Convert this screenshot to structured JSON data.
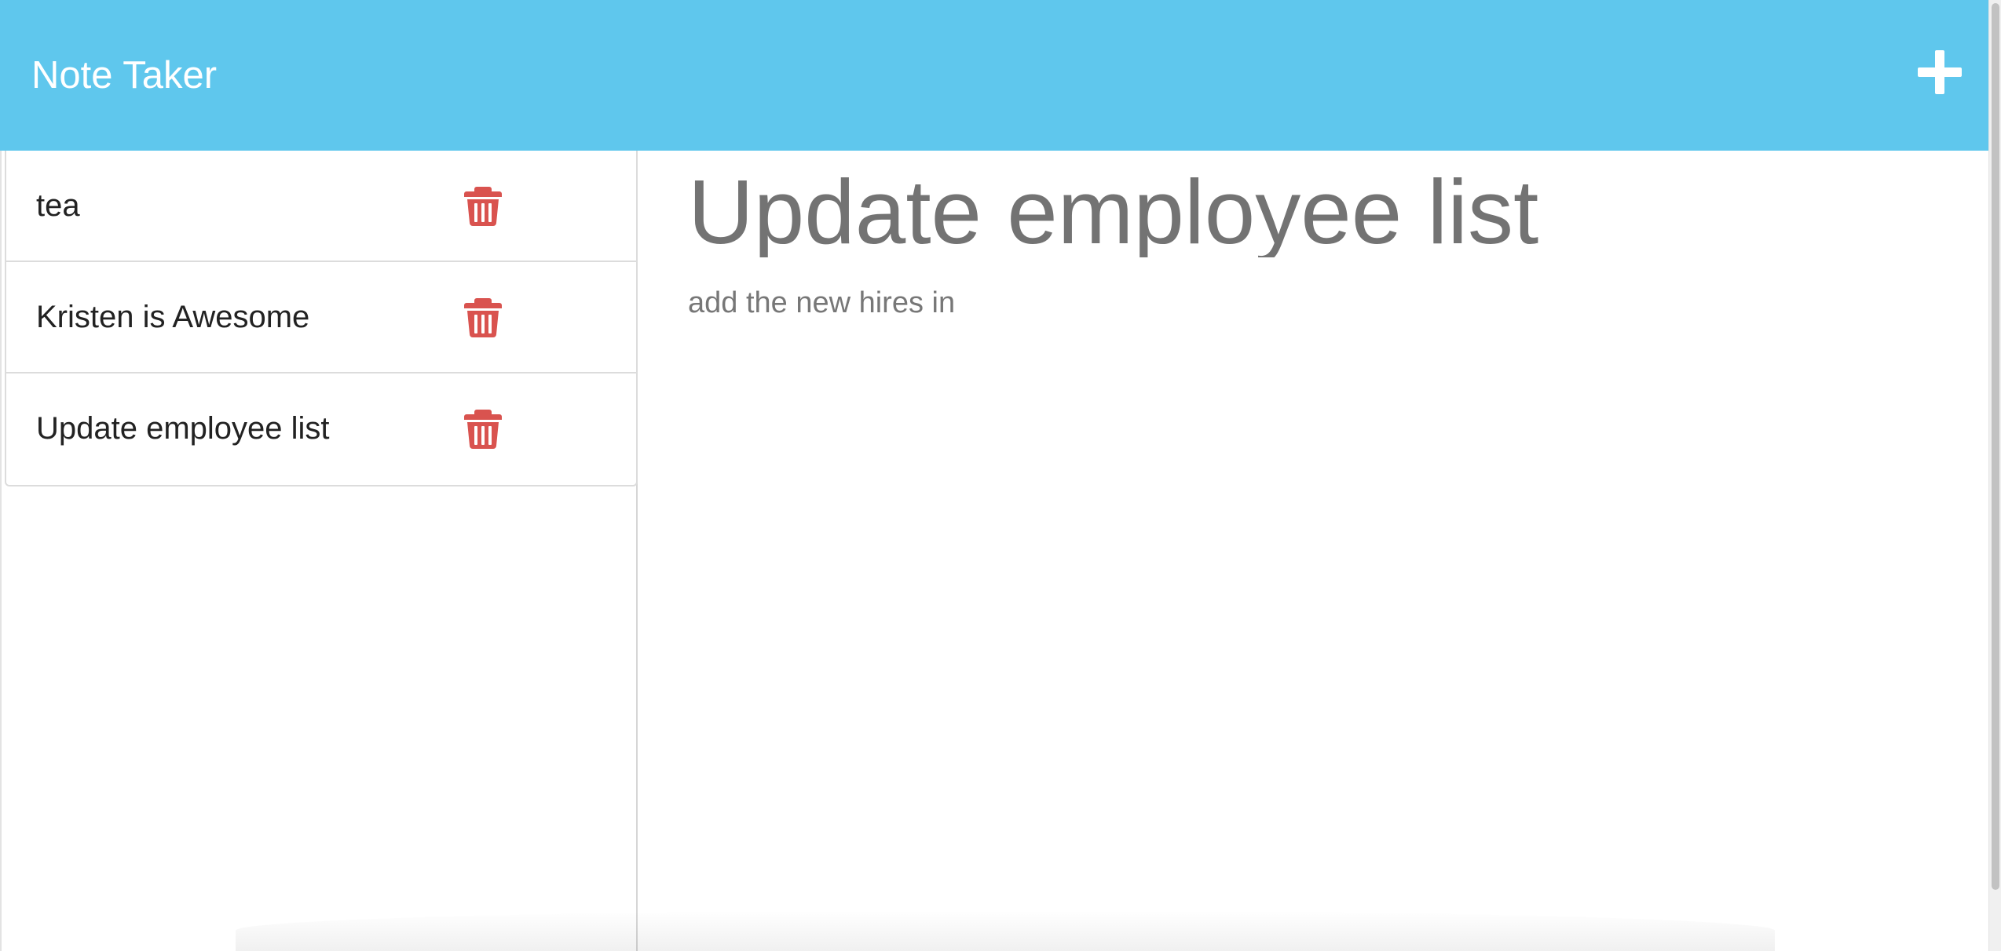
{
  "header": {
    "title": "Note Taker",
    "new_note_icon": "plus-icon",
    "background_color": "#5fc7ed"
  },
  "sidebar": {
    "notes": [
      {
        "title": "tea",
        "delete_icon": "trash-icon"
      },
      {
        "title": "Kristen is Awesome",
        "delete_icon": "trash-icon"
      },
      {
        "title": "Update employee list",
        "delete_icon": "trash-icon"
      }
    ],
    "delete_icon_color": "#d9534f"
  },
  "editor": {
    "title_value": "Update employee list",
    "text_value": "add the new hires in"
  }
}
